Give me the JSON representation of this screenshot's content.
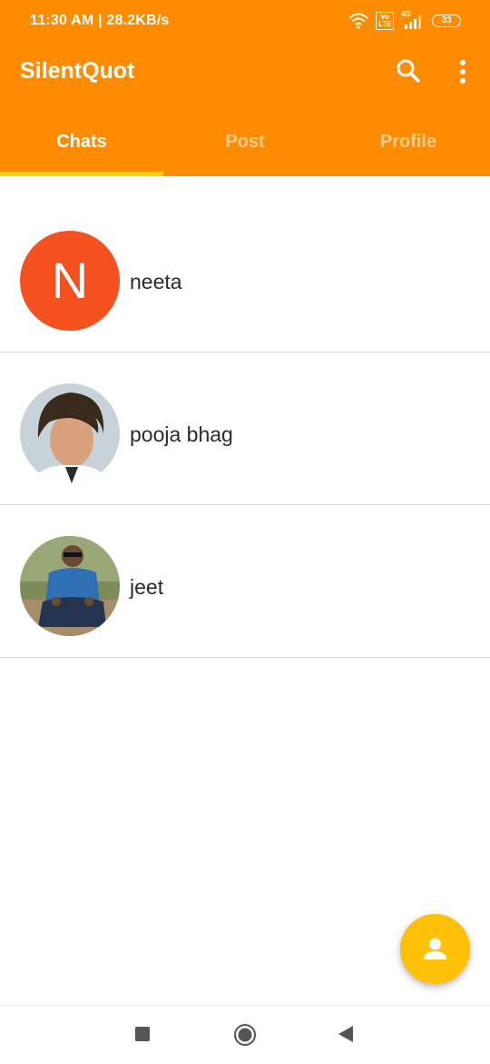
{
  "status_bar": {
    "time_speed": "11:30 AM | 28.2KB/s",
    "volte": "Vo LTE",
    "network": "4G",
    "battery": "33"
  },
  "app": {
    "title": "SilentQuot"
  },
  "tabs": [
    {
      "label": "Chats",
      "active": true
    },
    {
      "label": "Post",
      "active": false
    },
    {
      "label": "Profile",
      "active": false
    }
  ],
  "chats": [
    {
      "name": "neeta",
      "avatar_letter": "N"
    },
    {
      "name": "pooja bhag",
      "avatar_letter": ""
    },
    {
      "name": "jeet",
      "avatar_letter": ""
    }
  ],
  "colors": {
    "primary": "#FF8C00",
    "indicator": "#FFD400",
    "fab": "#FFC107",
    "avatar_letter_bg": "#F4511E"
  },
  "icons": {
    "search": "search-icon",
    "more": "more-vert-icon",
    "fab": "person-icon",
    "nav_recent": "square-icon",
    "nav_home": "circle-icon",
    "nav_back": "triangle-back-icon"
  }
}
